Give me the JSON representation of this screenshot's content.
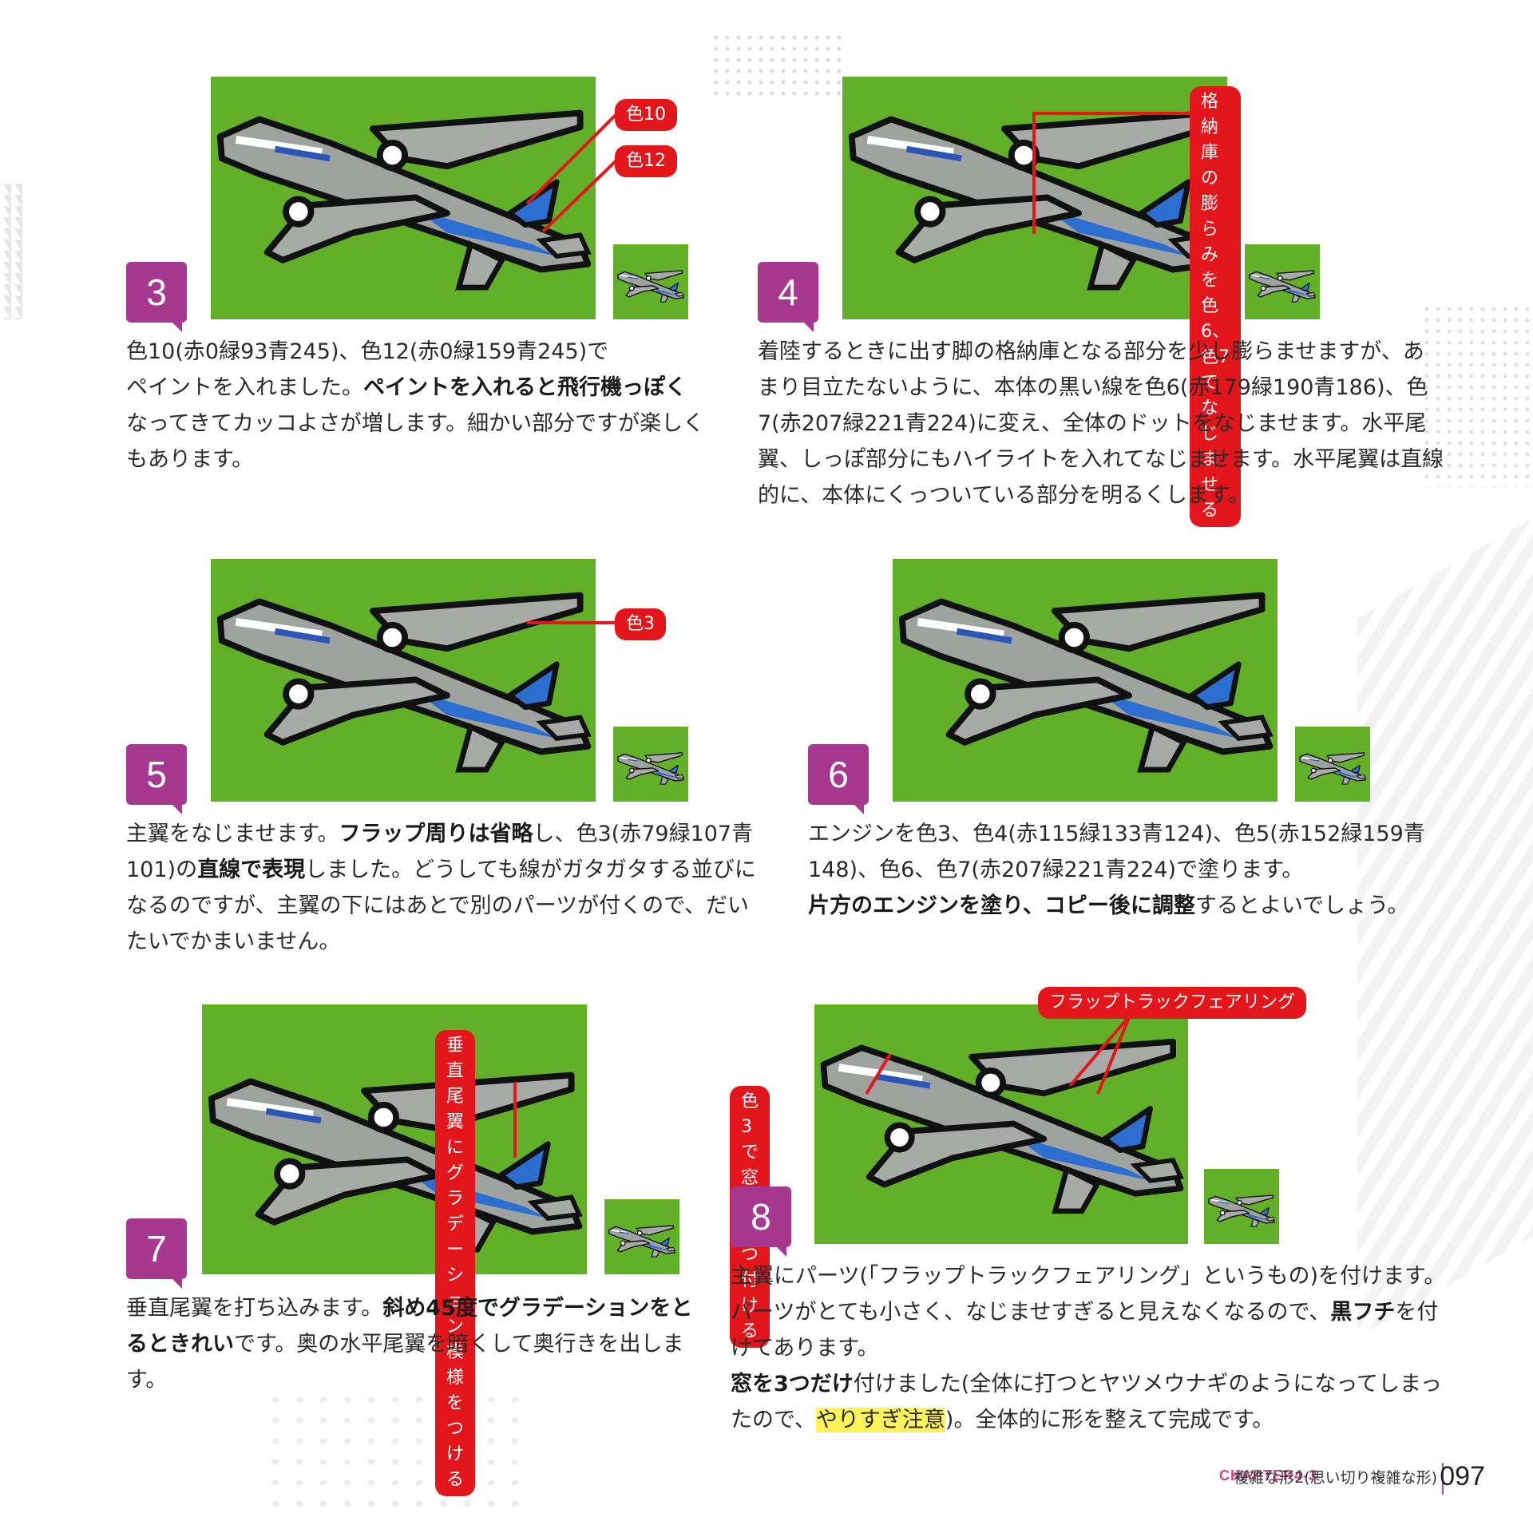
{
  "steps": [
    {
      "number": "3",
      "callouts": [
        "色10",
        "色12"
      ],
      "text_segments": [
        {
          "t": "色10(赤0緑93青245)、色12(赤0緑159青245)で"
        },
        {
          "t": "ペイントを入れました。"
        },
        {
          "t": "ペイントを入れると飛行機っぽく",
          "bold": true
        },
        {
          "t": "なってきてカッコよさが増します。細かい部分ですが楽しくもあります。"
        }
      ]
    },
    {
      "number": "4",
      "callouts": [
        "格納庫の膨らみを色6、\n色7でなじませる"
      ],
      "text_segments": [
        {
          "t": "着陸するときに出す脚の格納庫となる部分を少し膨らませますが、あまり目立たないように、本体の黒い線を色6(赤179緑190青186)、色7(赤207緑221青224)に変え、全体のドットをなじませます。水平尾翼、しっぽ部分にもハイライトを入れてなじませます。水平尾翼は直線的に、本体にくっついている部分を明るくします。"
        }
      ]
    },
    {
      "number": "5",
      "callouts": [
        "色3"
      ],
      "text_segments": [
        {
          "t": "主翼をなじませます。"
        },
        {
          "t": "フラップ周りは省略",
          "bold": true
        },
        {
          "t": "し、色3(赤79緑107青101)の"
        },
        {
          "t": "直線で表現",
          "bold": true
        },
        {
          "t": "しました。どうしても線がガタガタする並びになるのですが、主翼の下にはあとで別のパーツが付くので、だいたいでかまいません。"
        }
      ]
    },
    {
      "number": "6",
      "callouts": [],
      "text_segments": [
        {
          "t": "エンジンを色3、色4(赤115緑133青124)、色5(赤152緑159青148)、色6、色7(赤207緑221青224)で塗ります。"
        },
        {
          "t": "片方のエンジンを塗り、コピー後に調整",
          "bold": true
        },
        {
          "t": "するとよいでしょう。"
        }
      ]
    },
    {
      "number": "7",
      "callouts": [
        "垂直尾翼にグラデーション\n模様をつける"
      ],
      "text_segments": [
        {
          "t": "垂直尾翼を打ち込みます。"
        },
        {
          "t": "斜め45度でグラデーションをとるときれい",
          "bold": true
        },
        {
          "t": "です。奥の水平尾翼を暗くして奥行きを出します。"
        }
      ]
    },
    {
      "number": "8",
      "callouts": [
        "フラップトラックフェアリング",
        "色3で窓を\n3つ付ける"
      ],
      "text_segments": [
        {
          "t": "主翼にパーツ(「フラップトラックフェアリング」というもの)を付けます。パーツがとても小さく、なじませすぎると見えなくなるので、"
        },
        {
          "t": "黒フチ",
          "bold": true
        },
        {
          "t": "を付けてあります。"
        },
        {
          "t": "\n"
        },
        {
          "t": "窓を3つだけ",
          "bold": true
        },
        {
          "t": "付けました(全体に打つとヤツメウナギのようになってしまったので、"
        },
        {
          "t": "やりすぎ注意",
          "highlight": true
        },
        {
          "t": ")。全体的に形を整えて完成です。"
        }
      ]
    }
  ],
  "footer": {
    "chapter": "CHAPTER4-3",
    "title": "複雑な形2(思い切り複雑な形)",
    "page": "097"
  },
  "colors": {
    "panel_green": "#62b028",
    "number_badge": "#a6388f",
    "callout_red": "#e3161c",
    "highlight": "#fff35a"
  }
}
